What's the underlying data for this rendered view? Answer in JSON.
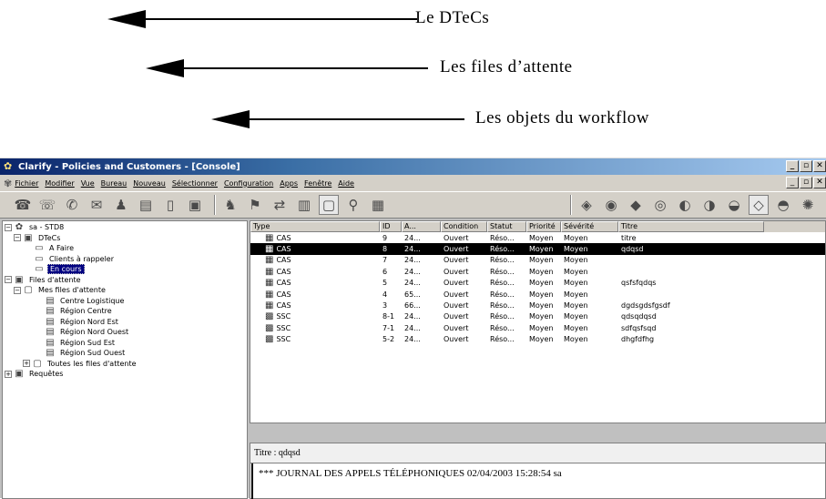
{
  "annotations": [
    {
      "label": "Le DTeCs"
    },
    {
      "label": "Les files d’attente"
    },
    {
      "label": "Les objets du workflow"
    }
  ],
  "window": {
    "title": "Clarify - Policies and Customers - [Console]",
    "controls": [
      "_",
      "▫",
      "✕"
    ]
  },
  "menubar": {
    "items": [
      "Fichier",
      "Modifier",
      "Vue",
      "Bureau",
      "Nouveau",
      "Sélectionner",
      "Configuration",
      "Apps",
      "Fenêtre",
      "Aide"
    ]
  },
  "tree": {
    "root": "sa - STD8",
    "dtecs": "DTeCs",
    "a_faire": "A Faire",
    "clients": "Clients à rappeler",
    "en_cours": "En cours",
    "files": "Files d'attente",
    "mes_files": "Mes files d'attente",
    "centre_logistique": "Centre Logistique",
    "region_centre": "Région Centre",
    "region_nord_est": "Région Nord Est",
    "region_nord_ouest": "Région Nord Ouest",
    "region_sud_est": "Région Sud Est",
    "region_sud_ouest": "Région Sud Ouest",
    "toutes_files": "Toutes les files d'attente",
    "requetes": "Requêtes"
  },
  "list": {
    "columns": [
      "Type",
      "ID",
      "A...",
      "Condition",
      "Statut",
      "Priorité",
      "Sévérité",
      "Titre"
    ],
    "rows": [
      {
        "type": "CAS",
        "id": "9",
        "a": "24...",
        "cond": "Ouvert",
        "stat": "Réso...",
        "prio": "Moyen",
        "sev": "Moyen",
        "titre": "titre"
      },
      {
        "type": "CAS",
        "id": "8",
        "a": "24...",
        "cond": "Ouvert",
        "stat": "Réso...",
        "prio": "Moyen",
        "sev": "Moyen",
        "titre": "qdqsd"
      },
      {
        "type": "CAS",
        "id": "7",
        "a": "24...",
        "cond": "Ouvert",
        "stat": "Réso...",
        "prio": "Moyen",
        "sev": "Moyen",
        "titre": ""
      },
      {
        "type": "CAS",
        "id": "6",
        "a": "24...",
        "cond": "Ouvert",
        "stat": "Réso...",
        "prio": "Moyen",
        "sev": "Moyen",
        "titre": ""
      },
      {
        "type": "CAS",
        "id": "5",
        "a": "24...",
        "cond": "Ouvert",
        "stat": "Réso...",
        "prio": "Moyen",
        "sev": "Moyen",
        "titre": "qsfsfqdqs"
      },
      {
        "type": "CAS",
        "id": "4",
        "a": "65...",
        "cond": "Ouvert",
        "stat": "Réso...",
        "prio": "Moyen",
        "sev": "Moyen",
        "titre": ""
      },
      {
        "type": "CAS",
        "id": "3",
        "a": "66...",
        "cond": "Ouvert",
        "stat": "Réso...",
        "prio": "Moyen",
        "sev": "Moyen",
        "titre": "dgdsgdsfgsdf"
      },
      {
        "type": "SSC",
        "id": "8-1",
        "a": "24...",
        "cond": "Ouvert",
        "stat": "Réso...",
        "prio": "Moyen",
        "sev": "Moyen",
        "titre": "qdsqdqsd"
      },
      {
        "type": "SSC",
        "id": "7-1",
        "a": "24...",
        "cond": "Ouvert",
        "stat": "Réso...",
        "prio": "Moyen",
        "sev": "Moyen",
        "titre": "sdfqsfsqd"
      },
      {
        "type": "SSC",
        "id": "5-2",
        "a": "24...",
        "cond": "Ouvert",
        "stat": "Réso...",
        "prio": "Moyen",
        "sev": "Moyen",
        "titre": "dhgfdfhg"
      }
    ],
    "selected_index": 1
  },
  "detail": {
    "title": "Titre : qdqsd",
    "body": "*** JOURNAL DES APPELS TÉLÉPHONIQUES 02/04/2003 15:28:54 sa"
  }
}
